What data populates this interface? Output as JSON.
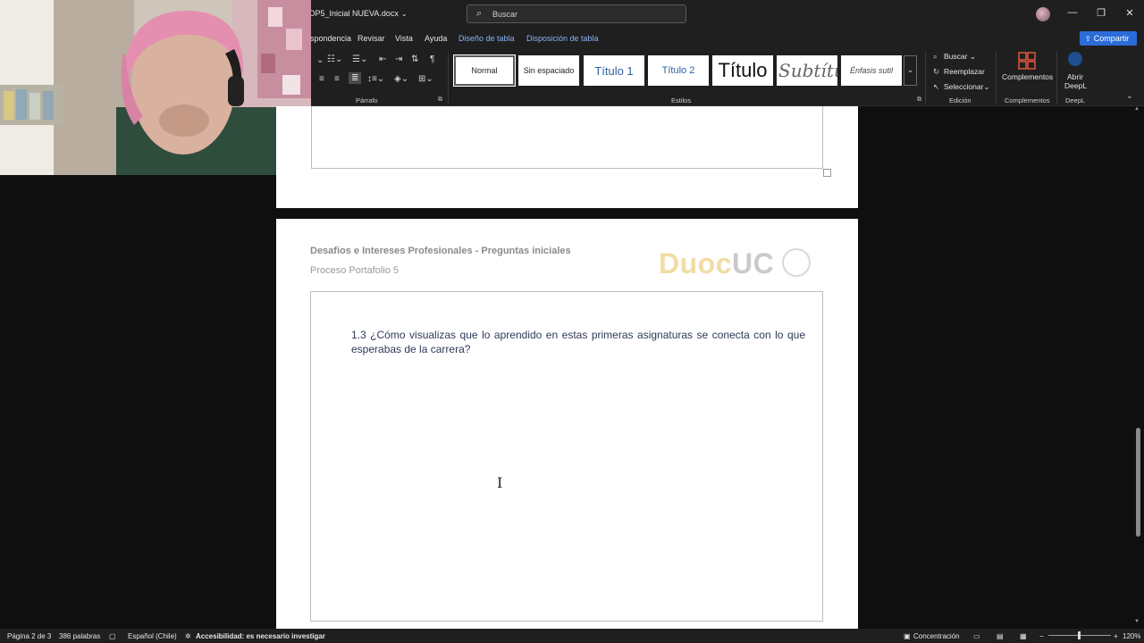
{
  "titlebar": {
    "doc_name": "DP5_Inicial NUEVA.docx",
    "search_placeholder": "Buscar",
    "minimize": "—",
    "restore": "❐",
    "close": "✕"
  },
  "ribbon_tabs": [
    {
      "label": "rrespondencia"
    },
    {
      "label": "Revisar"
    },
    {
      "label": "Vista"
    },
    {
      "label": "Ayuda"
    },
    {
      "label": "Diseño de tabla"
    },
    {
      "label": "Disposición de tabla"
    }
  ],
  "share_label": "Compartir",
  "ribbon": {
    "paragraph_group": "Párrafo",
    "styles_group": "Estilos",
    "editing_group": "Edición",
    "addins_group": "Complementos",
    "deepl_group": "DeepL",
    "styles": [
      {
        "label": "Normal"
      },
      {
        "label": "Sin espaciado"
      },
      {
        "label": "Título 1"
      },
      {
        "label": "Título 2"
      },
      {
        "label": "Título"
      },
      {
        "label": "Subtítu"
      },
      {
        "label": "Énfasis sutil"
      }
    ],
    "editing": {
      "find": "Buscar",
      "replace": "Reemplazar",
      "select": "Seleccionar"
    },
    "addins_button": "Complementos",
    "deepl_button_line1": "Abrir",
    "deepl_button_line2": "DeepL"
  },
  "document": {
    "header_title": "Desafios e Intereses Profesionales - Preguntas iniciales",
    "header_subtitle": "Proceso Portafolio 5",
    "logo_text_a": "Duoc",
    "logo_text_b": "UC",
    "question": "1.3 ¿Cómo visualizas que lo aprendido en estas primeras asignaturas se conecta con lo que esperabas de la carrera?"
  },
  "statusbar": {
    "page": "Página 2 de 3",
    "words": "386 palabras",
    "language": "Español (Chile)",
    "accessibility": "Accesibilidad: es necesario investigar",
    "focus": "Concentración",
    "zoom": "120%"
  },
  "colors": {
    "accent": "#8ab4f8",
    "share": "#2b6cd8",
    "logo_gold": "#e8c56a"
  }
}
